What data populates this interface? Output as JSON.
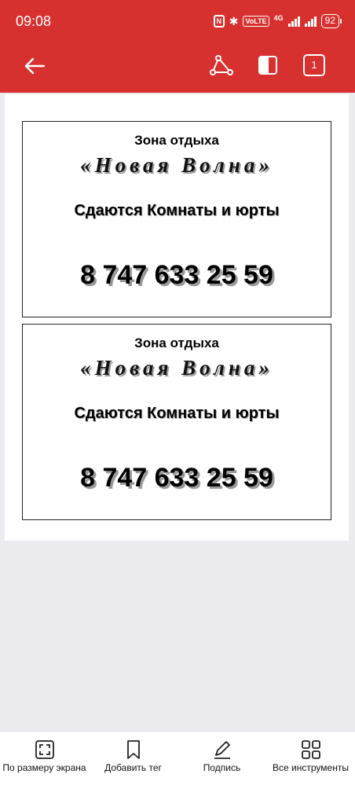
{
  "status_bar": {
    "time": "09:08",
    "nfc": "N",
    "volte": "VoLTE",
    "network": "4G",
    "battery": "92"
  },
  "toolbar": {
    "page_number": "1",
    "accent_color": "#d7312f"
  },
  "document": {
    "cards": [
      {
        "title": "Зона отдыха",
        "name": "«Новая Волна»",
        "rent_text": "Сдаются Комнаты и юрты",
        "phone": "8 747 633 25 59"
      },
      {
        "title": "Зона отдыха",
        "name": "«Новая Волна»",
        "rent_text": "Сдаются Комнаты и юрты",
        "phone": "8 747 633 25 59"
      }
    ]
  },
  "bottom_bar": {
    "tools": [
      {
        "label": "По размеру экрана",
        "icon": "fit-screen-icon"
      },
      {
        "label": "Добавить тег",
        "icon": "bookmark-icon"
      },
      {
        "label": "Подпись",
        "icon": "pen-icon"
      },
      {
        "label": "Все инструменты",
        "icon": "grid-icon"
      }
    ]
  }
}
